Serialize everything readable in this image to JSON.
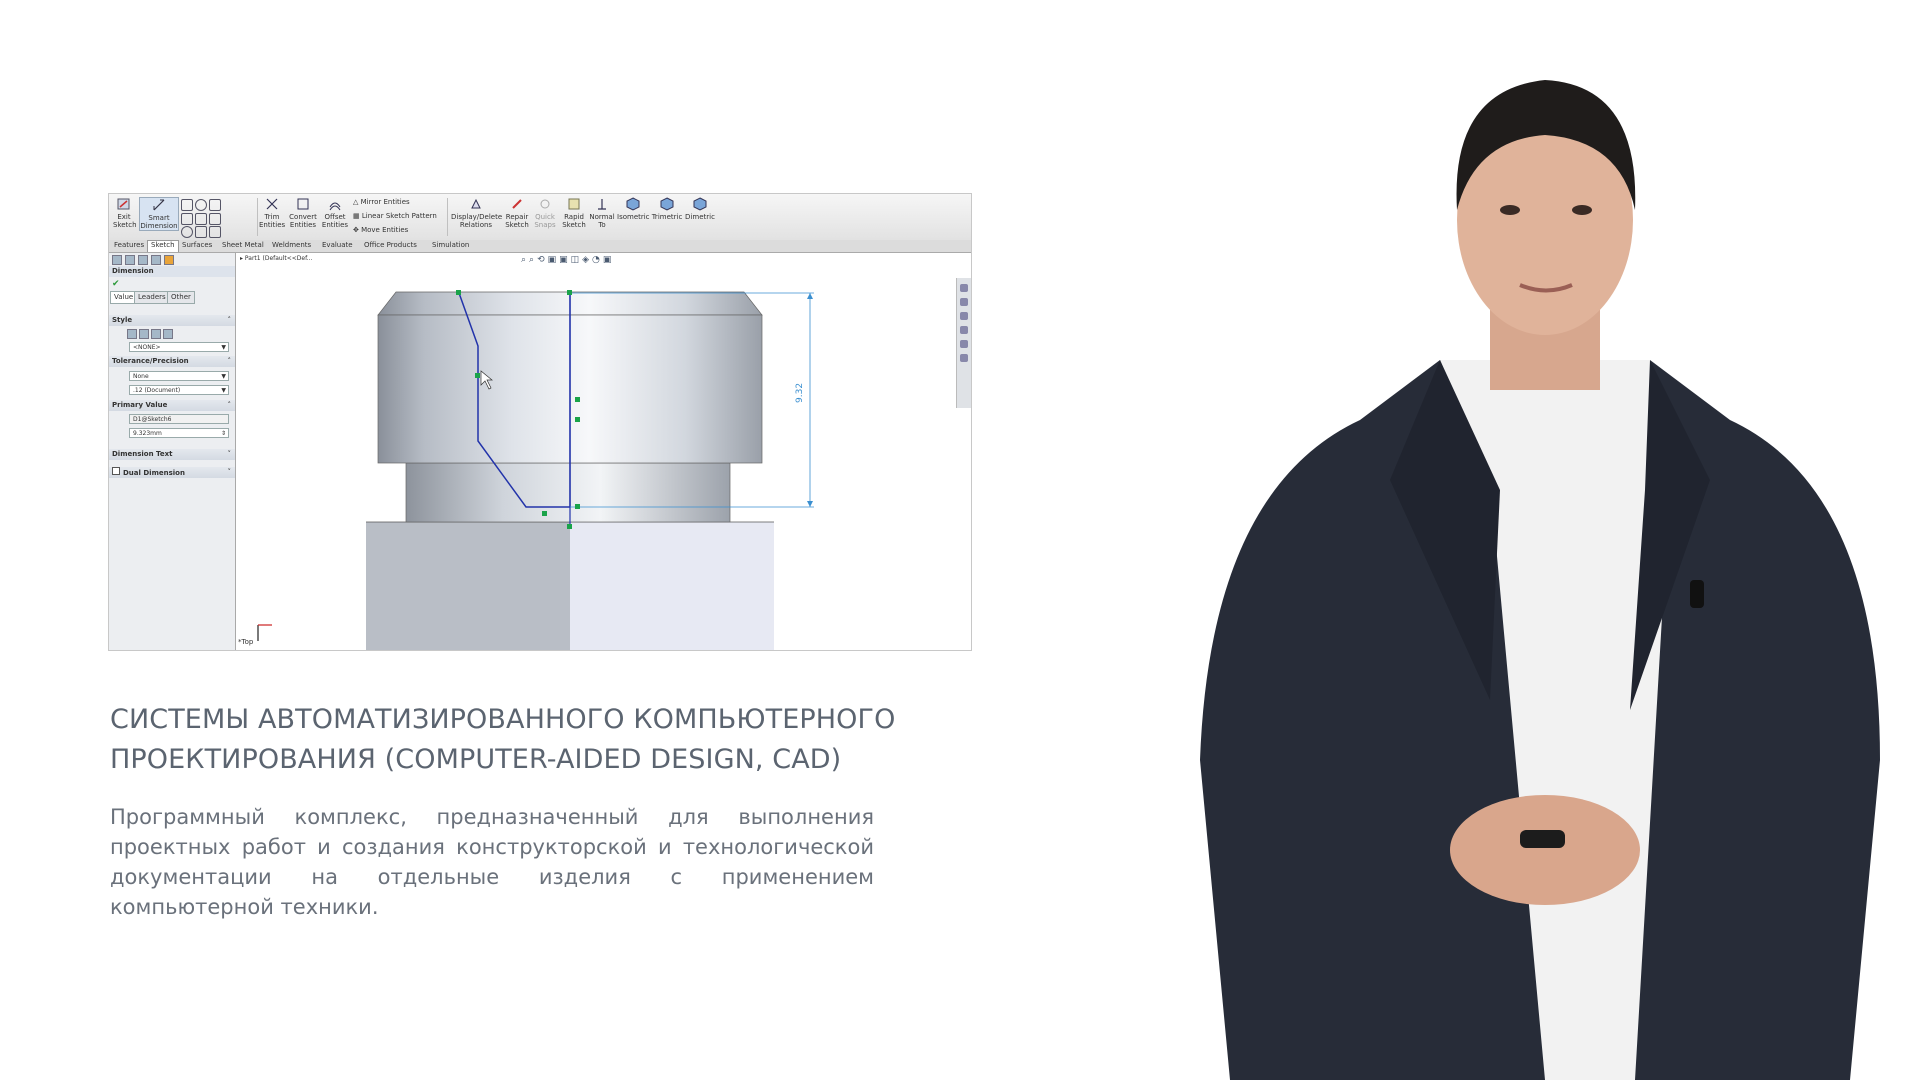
{
  "cad": {
    "toolbar": {
      "exit_sketch": "Exit Sketch",
      "smart_dimension": "Smart Dimension",
      "trim_entities": "Trim Entities",
      "convert_entities": "Convert Entities",
      "offset_entities": "Offset Entities",
      "mirror_entities": "Mirror Entities",
      "linear_sketch_pattern": "Linear Sketch Pattern",
      "move_entities": "Move Entities",
      "display_delete_relations": "Display/Delete Relations",
      "repair_sketch": "Repair Sketch",
      "quick_snaps": "Quick Snaps",
      "rapid_sketch": "Rapid Sketch",
      "normal_to": "Normal To",
      "isometric": "Isometric",
      "trimetric": "Trimetric",
      "dimetric": "Dimetric"
    },
    "tabs": [
      "Features",
      "Sketch",
      "Surfaces",
      "Sheet Metal",
      "Weldments",
      "Evaluate",
      "Office Products",
      "Simulation"
    ],
    "active_tab": "Sketch",
    "panel": {
      "title": "Dimension",
      "subtabs": [
        "Value",
        "Leaders",
        "Other"
      ],
      "style_header": "Style",
      "style_value": "<NONE>",
      "tolerance_header": "Tolerance/Precision",
      "tolerance_value": "None",
      "precision_value": ".12 (Document)",
      "primary_header": "Primary Value",
      "primary_name": "D1@Sketch6",
      "primary_value": "9.323mm",
      "dimension_text_header": "Dimension Text",
      "dual_dimension_label": "Dual Dimension"
    },
    "tree_label": "Part1 (Default<<Def...",
    "dimension_label": "9.32",
    "orientation_label": "*Top",
    "colors": {
      "sketch_line": "#2233aa",
      "dimension_line": "#3a8fd0",
      "sketch_point": "#1aa34a",
      "part_gray": "#b9bec6"
    }
  },
  "heading_line1": "СИСТЕМЫ АВТОМАТИЗИРОВАННОГО КОМПЬЮТЕРНОГО",
  "heading_line2": "ПРОЕКТИРОВАНИЯ (COMPUTER-AIDED DESIGN, CAD)",
  "description": "Программный комплекс, предназначенный для выполнения проектных работ и создания конструкторской и технологической документации на отдельные изделия с применением компьютерной техники."
}
